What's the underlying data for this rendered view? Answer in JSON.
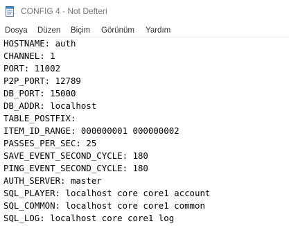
{
  "window": {
    "title": "CONFIG 4 - Not Defteri",
    "app_icon": "notepad-icon"
  },
  "menu": {
    "items": [
      {
        "label": "Dosya"
      },
      {
        "label": "Düzen"
      },
      {
        "label": "Biçim"
      },
      {
        "label": "Görünüm"
      },
      {
        "label": "Yardım"
      }
    ]
  },
  "editor": {
    "lines": [
      "HOSTNAME: auth",
      "CHANNEL: 1",
      "PORT: 11002",
      "P2P_PORT: 12789",
      "DB_PORT: 15000",
      "DB_ADDR: localhost",
      "TABLE_POSTFIX:",
      "ITEM_ID_RANGE: 000000001 000000002",
      "PASSES_PER_SEC: 25",
      "SAVE_EVENT_SECOND_CYCLE: 180",
      "PING_EVENT_SECOND_CYCLE: 180",
      "AUTH_SERVER: master",
      "SQL_PLAYER: localhost core core1 account",
      "SQL_COMMON: localhost core core1 common",
      "SQL_LOG: localhost core core1 log"
    ]
  }
}
